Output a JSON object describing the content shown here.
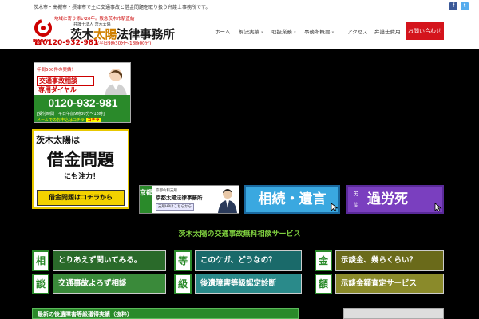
{
  "topbar": {
    "tagline": "茨木市・高槻市・摂津市で主に交通事故と借金問題を取り扱う弁護士事務所です。",
    "facebook_label": "f",
    "twitter_label": "t"
  },
  "logo": {
    "tagline": "地域に寄り添い20年。阪急茨木市駅直結",
    "subtitle": "弁護士法人 茨木太陽",
    "mark_text": "IBARAKI",
    "name_pre": "茨木",
    "name_hl": "太陽",
    "name_post": "法律事務所",
    "phone": "☎0120-932-981",
    "hours": "(平日9時30分〜18時00分)"
  },
  "nav": {
    "items": [
      {
        "label": "ホーム",
        "caret": ""
      },
      {
        "label": "解決実績",
        "caret": "▾"
      },
      {
        "label": "取扱業務",
        "caret": "▾"
      },
      {
        "label": "事務所概要",
        "caret": "▾"
      },
      {
        "label": "アクセス",
        "caret": ""
      },
      {
        "label": "弁護士費用",
        "caret": ""
      }
    ],
    "contact": "お問い合わせ"
  },
  "promo_phone": {
    "count": "年間500件の実績！",
    "head1": "交通事故相談",
    "head2": "専用ダイヤル",
    "tel": "0120-932-981",
    "hours": "[受付時間　平日午前9時30分〜18時]",
    "mail": "メールでのお申込はコチラ",
    "mail_btn": "コチラ"
  },
  "promo_debt": {
    "l1": "茨木太陽は",
    "l2": "借金問題",
    "l3": "にも注力！",
    "btn": "借金問題はコチラから"
  },
  "banners": {
    "kyoto_tag": "京都",
    "kyoto_small": "京都山科支所",
    "kyoto_name": "京都太陽法律事務所",
    "kyoto_link": "支所HPはこちらから",
    "souzoku": "相続・遺言",
    "karoushi_tag": "労災",
    "karoushi": "過労死"
  },
  "section_title": "茨木太陽の交通事故無料相談サービス",
  "services": [
    {
      "tag1": "相",
      "tag2": "談",
      "row1": "とりあえず聞いてみる。",
      "row2": "交通事故よろず相談"
    },
    {
      "tag1": "等",
      "tag2": "級",
      "row1": "このケガ、どうなの？",
      "row2": "後遺障害等級認定診断"
    },
    {
      "tag1": "金",
      "tag2": "額",
      "row1": "示談金、幾らくらい？",
      "row2": "示談金額査定サービス"
    }
  ],
  "news_bar": "最新の後遺障害等級獲得実績（抜粋）",
  "colors": {
    "accent_red": "#d4141c",
    "brand_green": "#2a8a2a",
    "section_green": "#7fcf3f"
  }
}
